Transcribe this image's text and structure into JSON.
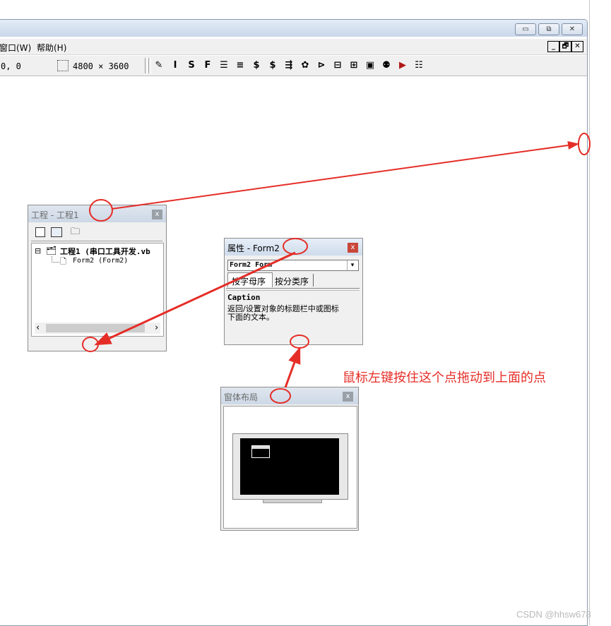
{
  "window": {
    "minimize_glyph": "▭",
    "restore_glyph": "⧉",
    "close_glyph": "✕"
  },
  "menu": {
    "items": [
      "窗口(W)",
      "帮助(H)"
    ],
    "mdi_buttons": [
      "_",
      "🗗",
      "✕"
    ]
  },
  "toolbar": {
    "position": "0, 0",
    "size": "4800 × 3600",
    "format_icons": [
      "✎",
      "I",
      "S",
      "F",
      "☰",
      "≡",
      "$",
      "$",
      "⇶",
      "✿",
      "⊳",
      "⊟",
      "⊞",
      "▣",
      "⚉",
      "▶",
      "☷"
    ]
  },
  "project_window": {
    "title": "工程 - 工程1",
    "close_label": "x",
    "toolbar_icons": [
      "view-code-icon",
      "view-object-icon",
      "toggle-folders-icon"
    ],
    "tree": {
      "root_expander": "⊟",
      "root_label": "工程1 (串口工具开发.vb",
      "child_label": "Form2 (Form2)"
    },
    "scroll_left": "‹",
    "scroll_right": "›"
  },
  "properties_window": {
    "title": "属性 - Form2",
    "close_label": "x",
    "object_select": "Form2 Form",
    "tabs": [
      "按字母序",
      "按分类序"
    ],
    "desc_title": "Caption",
    "desc_text_line1": "返回/设置对象的标题栏中或图标",
    "desc_text_line2": "下面的文本。"
  },
  "layout_window": {
    "title": "窗体布局",
    "close_label": "x"
  },
  "annotation": {
    "text": "鼠标左键按住这个点拖动到上面的点",
    "color": "#e52d27"
  },
  "watermark": "CSDN @hhsw678"
}
